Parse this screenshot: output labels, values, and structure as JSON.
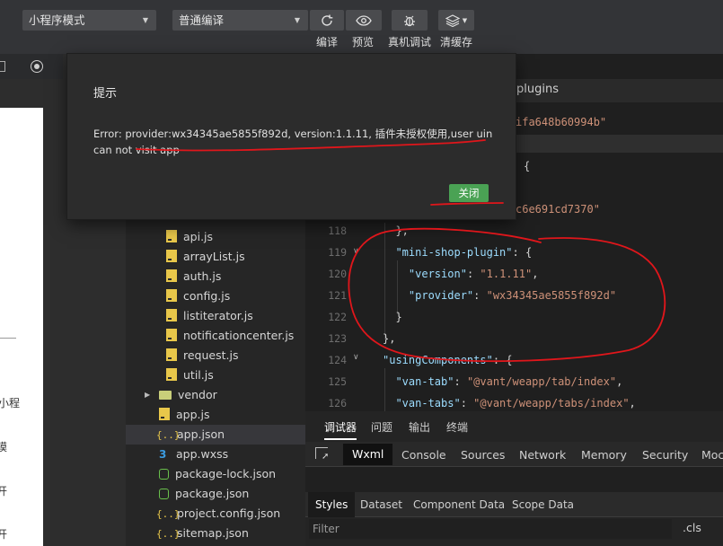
{
  "toolbar": {
    "mode_select": "小程序模式",
    "compile_select": "普通编译",
    "buttons": {
      "compile": "编译",
      "preview": "预览",
      "debug": "真机调试",
      "clear_cache": "清缓存"
    }
  },
  "simulator": {
    "fragments": [
      "小程",
      "模",
      "开",
      "开"
    ]
  },
  "file_tree": {
    "items": [
      {
        "name": "api.js",
        "icon": "js-icon"
      },
      {
        "name": "arrayList.js",
        "icon": "js-icon"
      },
      {
        "name": "auth.js",
        "icon": "js-icon"
      },
      {
        "name": "config.js",
        "icon": "js-icon"
      },
      {
        "name": "listiterator.js",
        "icon": "js-icon"
      },
      {
        "name": "notificationcenter.js",
        "icon": "js-icon"
      },
      {
        "name": "request.js",
        "icon": "js-icon"
      },
      {
        "name": "util.js",
        "icon": "js-icon"
      },
      {
        "name": "vendor",
        "icon": "folder-icon"
      },
      {
        "name": "app.js",
        "icon": "js-icon"
      },
      {
        "name": "app.json",
        "icon": "json-icon"
      },
      {
        "name": "app.wxss",
        "icon": "css-icon"
      },
      {
        "name": "package-lock.json",
        "icon": "package-icon"
      },
      {
        "name": "package.json",
        "icon": "package-icon"
      },
      {
        "name": "project.config.json",
        "icon": "json-icon"
      },
      {
        "name": "sitemap.json",
        "icon": "json-icon"
      }
    ],
    "selected": "app.json",
    "json_icon_glyph": "{..}",
    "css_icon_glyph": "3"
  },
  "editor": {
    "title": "plugins",
    "visible_fragments": [
      "ifa648b60994b\"",
      "{",
      "c6e691cd7370\""
    ],
    "line_numbers": [
      "118",
      "119",
      "120",
      "121",
      "122",
      "123",
      "124",
      "125",
      "126"
    ],
    "lines": [
      {
        "indent": "  ",
        "parts": [
          {
            "t": "},",
            "c": "p"
          }
        ]
      },
      {
        "indent": "  ",
        "parts": [
          {
            "t": "\"mini-shop-plugin\"",
            "c": "k"
          },
          {
            "t": ": {",
            "c": "p"
          }
        ]
      },
      {
        "indent": "    ",
        "parts": [
          {
            "t": "\"version\"",
            "c": "k"
          },
          {
            "t": ": ",
            "c": "p"
          },
          {
            "t": "\"1.1.11\"",
            "c": "s"
          },
          {
            "t": ",",
            "c": "p"
          }
        ]
      },
      {
        "indent": "    ",
        "parts": [
          {
            "t": "\"provider\"",
            "c": "k"
          },
          {
            "t": ": ",
            "c": "p"
          },
          {
            "t": "\"wx34345ae5855f892d\"",
            "c": "s"
          }
        ]
      },
      {
        "indent": "  ",
        "parts": [
          {
            "t": "}",
            "c": "p"
          }
        ]
      },
      {
        "indent": "",
        "parts": [
          {
            "t": "},",
            "c": "p"
          }
        ]
      },
      {
        "indent": "",
        "parts": [
          {
            "t": "\"usingComponents\"",
            "c": "k"
          },
          {
            "t": ": {",
            "c": "p"
          }
        ]
      },
      {
        "indent": "  ",
        "parts": [
          {
            "t": "\"van-tab\"",
            "c": "k"
          },
          {
            "t": ": ",
            "c": "p"
          },
          {
            "t": "\"@vant/weapp/tab/index\"",
            "c": "s"
          },
          {
            "t": ",",
            "c": "p"
          }
        ]
      },
      {
        "indent": "  ",
        "parts": [
          {
            "t": "\"van-tabs\"",
            "c": "k"
          },
          {
            "t": ": ",
            "c": "p"
          },
          {
            "t": "\"@vant/weapp/tabs/index\"",
            "c": "s"
          },
          {
            "t": ",",
            "c": "p"
          }
        ]
      }
    ]
  },
  "devtools": {
    "top_tabs": [
      "调试器",
      "问题",
      "输出",
      "终端"
    ],
    "active_top_tab": "调试器",
    "panel_tabs": [
      "Wxml",
      "Console",
      "Sources",
      "Network",
      "Memory",
      "Security",
      "Moc"
    ],
    "active_panel_tab": "Wxml",
    "sub_tabs": [
      "Styles",
      "Dataset",
      "Component Data",
      "Scope Data"
    ],
    "active_sub_tab": "Styles",
    "filter_placeholder": "Filter",
    "cls_label": ".cls"
  },
  "modal": {
    "title": "提示",
    "message": "Error: provider:wx34345ae5855f892d, version:1.1.11, 插件未授权使用,user uin can not visit app",
    "close_button": "关闭"
  },
  "colors": {
    "toolbar_bg": "#333437",
    "accent_green": "#4aa254",
    "annotation_red": "#e0161b",
    "json_key": "#9cdcfe",
    "json_string": "#ce9178"
  }
}
